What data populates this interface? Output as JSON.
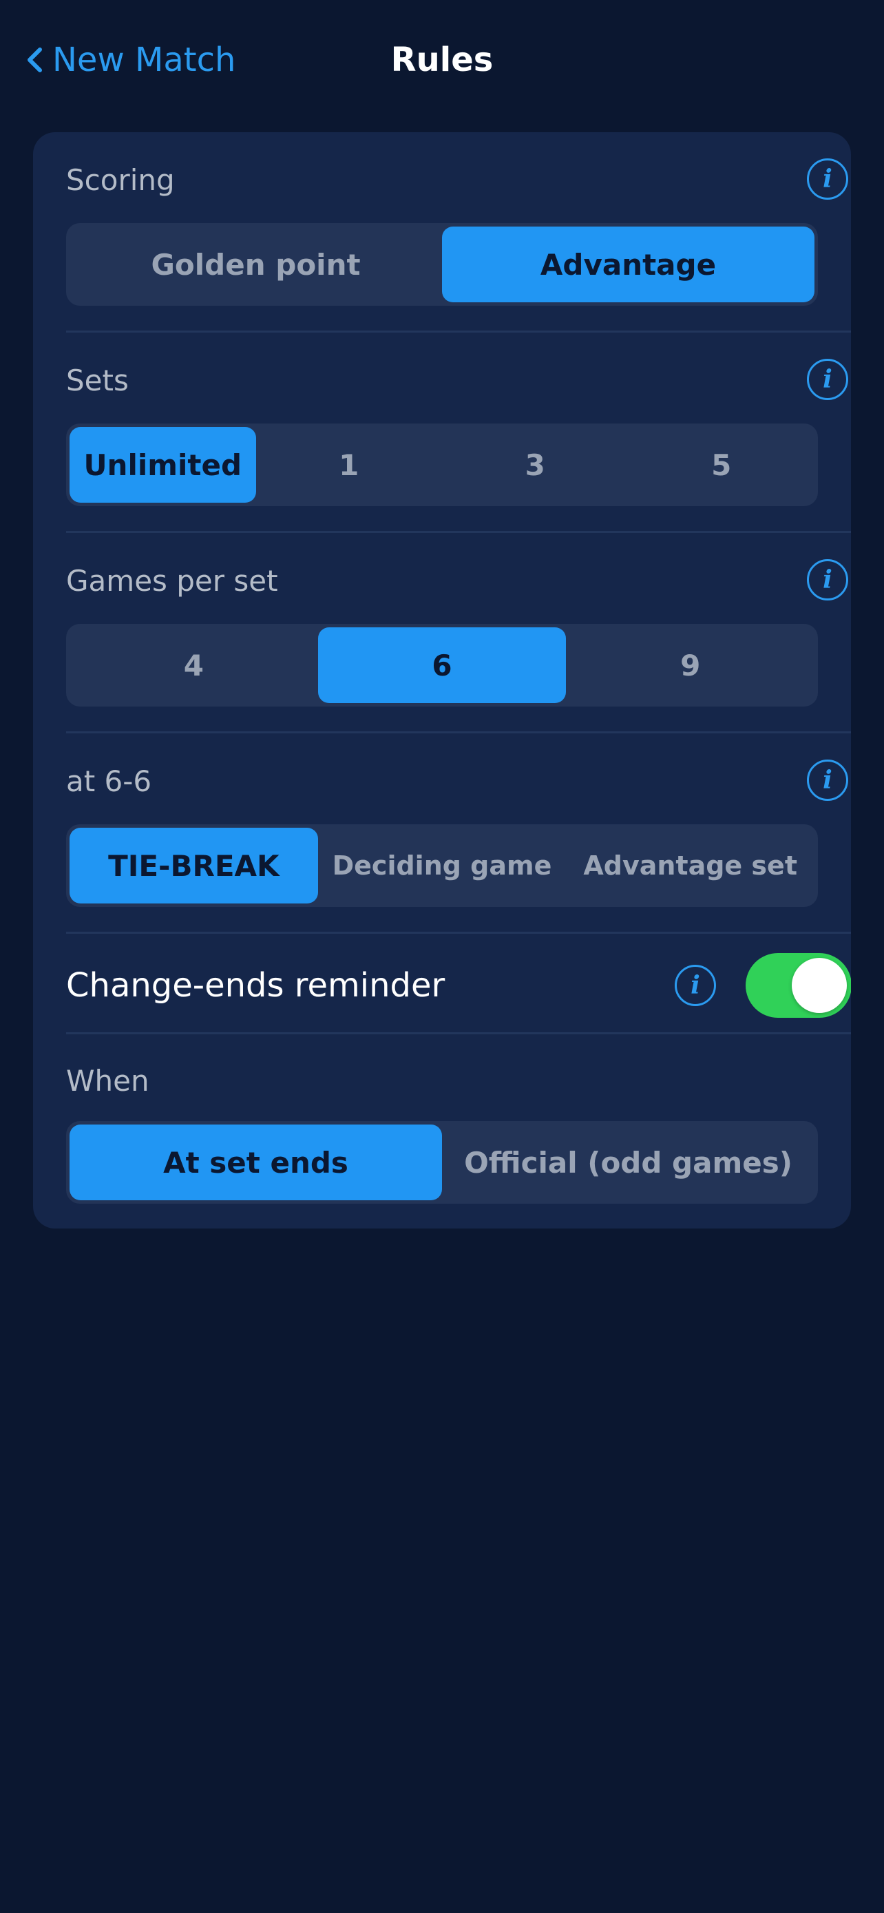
{
  "nav": {
    "back_label": "New Match",
    "title": "Rules"
  },
  "info_glyph": "i",
  "scoring": {
    "label": "Scoring",
    "options": [
      "Golden point",
      "Advantage"
    ],
    "selected": "Advantage"
  },
  "sets": {
    "label": "Sets",
    "options": [
      "Unlimited",
      "1",
      "3",
      "5"
    ],
    "selected": "Unlimited"
  },
  "games_per_set": {
    "label": "Games per set",
    "options": [
      "4",
      "6",
      "9"
    ],
    "selected": "6"
  },
  "at_tie": {
    "label": "at 6-6",
    "options": [
      "TIE-BREAK",
      "Deciding game",
      "Advantage set"
    ],
    "selected": "TIE-BREAK"
  },
  "change_ends": {
    "label": "Change-ends reminder",
    "enabled": true
  },
  "when": {
    "label": "When",
    "options": [
      "At set ends",
      "Official (odd games)"
    ],
    "selected": "At set ends"
  },
  "colors": {
    "background": "#0b1730",
    "card": "#15264a",
    "accent": "#2196f3",
    "toggle_on": "#30d158"
  }
}
